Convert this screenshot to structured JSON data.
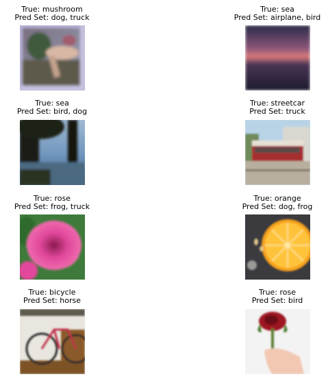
{
  "items": [
    {
      "true_text": "True: mushroom",
      "pred_text": "Pred Set: dog, truck",
      "icon": "mushroom-photo"
    },
    {
      "true_text": "True: sea",
      "pred_text": "Pred Set: airplane, bird",
      "icon": "sea-sunset-photo"
    },
    {
      "true_text": "True: sea",
      "pred_text": "Pred Set: bird, dog",
      "icon": "sea-trees-photo"
    },
    {
      "true_text": "True: streetcar",
      "pred_text": "Pred Set: truck",
      "icon": "streetcar-photo"
    },
    {
      "true_text": "True: rose",
      "pred_text": "Pred Set: frog, truck",
      "icon": "pink-rose-photo"
    },
    {
      "true_text": "True: orange",
      "pred_text": "Pred Set: dog, frog",
      "icon": "orange-slice-photo"
    },
    {
      "true_text": "True: bicycle",
      "pred_text": "Pred Set: horse",
      "icon": "bicycle-photo"
    },
    {
      "true_text": "True: rose",
      "pred_text": "Pred Set: bird",
      "icon": "red-rose-hand-photo"
    }
  ]
}
